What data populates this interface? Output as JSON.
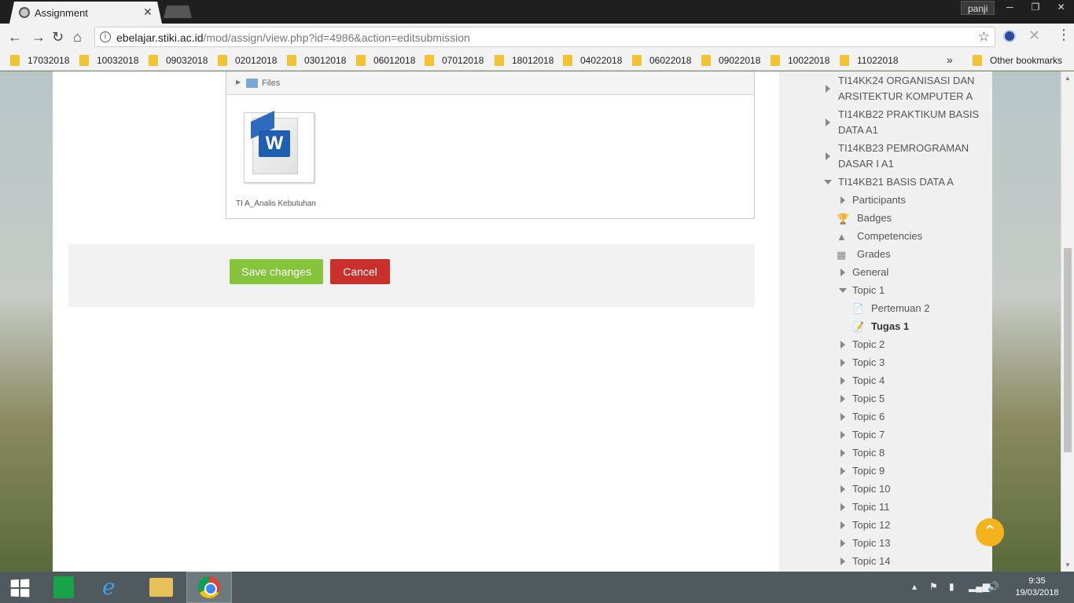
{
  "browser": {
    "tab_title": "Assignment",
    "profile_name": "panji",
    "url_host": "ebelajar.stiki.ac.id",
    "url_path": "/mod/assign/view.php?id=4986&action=editsubmission",
    "bookmarks": [
      "17032018",
      "10032018",
      "09032018",
      "02012018",
      "03012018",
      "06012018",
      "07012018",
      "18012018",
      "04022018",
      "06022018",
      "09022018",
      "10022018",
      "11022018"
    ],
    "bookmarks_overflow": "»",
    "other_bookmarks": "Other bookmarks"
  },
  "files": {
    "section_label": "Files",
    "file_name": "TI A_Analis Kebutuhan",
    "file_icon_letter": "W"
  },
  "actions": {
    "save_label": "Save changes",
    "cancel_label": "Cancel"
  },
  "nav": {
    "courses": [
      {
        "label_line1": "TI14KK24 ORGANISASI DAN",
        "label_line2": "ARSITEKTUR KOMPUTER A"
      },
      {
        "label_line1": "TI14KB22 PRAKTIKUM BASIS",
        "label_line2": "DATA A1"
      },
      {
        "label_line1": "TI14KB23 PEMROGRAMAN",
        "label_line2": "DASAR I A1"
      }
    ],
    "current_course": "TI14KB21 BASIS DATA A",
    "course_items": [
      "Participants",
      "Badges",
      "Competencies",
      "Grades",
      "General"
    ],
    "open_topic": "Topic 1",
    "topic1_items": [
      "Pertemuan 2",
      "Tugas 1"
    ],
    "topics": [
      "Topic 2",
      "Topic 3",
      "Topic 4",
      "Topic 5",
      "Topic 6",
      "Topic 7",
      "Topic 8",
      "Topic 9",
      "Topic 10",
      "Topic 11",
      "Topic 12",
      "Topic 13",
      "Topic 14"
    ]
  },
  "taskbar": {
    "time": "9:35",
    "date": "19/03/2018"
  },
  "colors": {
    "save_button": "#86c43c",
    "cancel_button": "#c9302c",
    "scroll_top_button": "#f3b31c"
  }
}
